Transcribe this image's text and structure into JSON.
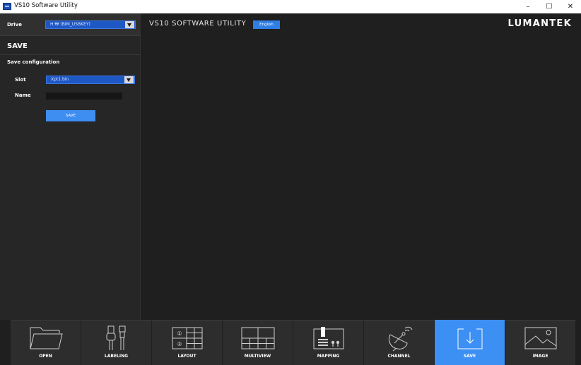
{
  "window": {
    "title": "VS10 Software Utility",
    "controls": {
      "minimize": "–",
      "maximize": "☐",
      "close": "✕"
    }
  },
  "header": {
    "app_name": "VS10 SOFTWARE UTILITY",
    "language": "English",
    "brand": "LUMANTEK"
  },
  "sidebar": {
    "drive_label": "Drive",
    "drive_value": "H:₩ (BIM_USBKEY)",
    "panel_title": "SAVE",
    "section_title": "Save configuration",
    "slot_label": "Slot",
    "slot_value": "Xpt1.bin",
    "name_label": "Name",
    "name_value": "",
    "save_button": "SAVE"
  },
  "toolbar": {
    "items": [
      {
        "id": "open",
        "label": "OPEN",
        "icon": "folder-icon",
        "active": false
      },
      {
        "id": "labeling",
        "label": "LABELING",
        "icon": "connector-icon",
        "active": false
      },
      {
        "id": "layout",
        "label": "LAYOUT",
        "icon": "layout-grid-icon",
        "active": false
      },
      {
        "id": "multiview",
        "label": "MULTIVIEW",
        "icon": "multiview-grid-icon",
        "active": false
      },
      {
        "id": "mapping",
        "label": "MAPPING",
        "icon": "mapping-device-icon",
        "active": false
      },
      {
        "id": "channel",
        "label": "CHANNEL",
        "icon": "satellite-dish-icon",
        "active": false
      },
      {
        "id": "save",
        "label": "SAVE",
        "icon": "download-tray-icon",
        "active": true
      },
      {
        "id": "image",
        "label": "IMAGE",
        "icon": "image-icon",
        "active": false
      }
    ],
    "layout_icon_digits": [
      "①",
      "②"
    ]
  },
  "colors": {
    "accent": "#3c8ff3",
    "select_bg": "#1e58c4",
    "panel_bg": "#262626",
    "workspace_bg": "#1f1f1f",
    "tool_bg": "#2d2d2d"
  }
}
